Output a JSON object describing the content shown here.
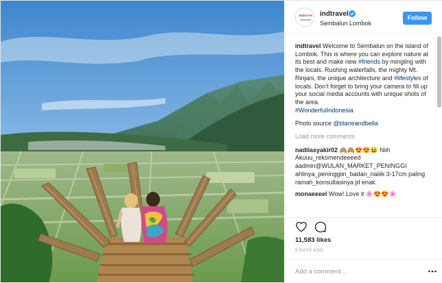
{
  "post": {
    "username": "indtravel",
    "location": "Sembalun Lombok",
    "follow_label": "Follow",
    "avatar_text": "indtravel",
    "avatar_subtext": "indonesia",
    "photo_alt": "Sembalun, Lombok"
  },
  "caption": {
    "username": "indtravel",
    "text_1": " Welcome to Sembalun on the island of Lombok. This is where you can explore nature at its best and make new ",
    "tag_1": "#friends",
    "text_2": " by mingling with the locals. Rushing waterfalls, the mighty Mt. Rinjani, the unique architecture and ",
    "tag_2": "#lifestyles",
    "text_3": " of locals. Don't forget to bring your camera to fill up your social media accounts with unique shots of the area.",
    "tag_3": "#WonderfulIndonesia",
    "source_label": "Photo source ",
    "source_handle": "@blaneandbella"
  },
  "load_more_label": "Load more comments",
  "comments": [
    {
      "username": "nadilasyakir02",
      "text": " 🙈🙈😍😍😆  Niih Akuuu_rekomendeeeed aadmin@WULAN_MARKET_PENINGGI ahlinya_peninggiin_badan_naiiik 3-17cm paling ramah_konsultasinya jd enak."
    },
    {
      "username": "monaeeeel",
      "text": " Wow! Love it 🌸😍😍🌸"
    }
  ],
  "likes_label": "11,583 likes",
  "time_label": "5 DAYS AGO",
  "add_comment_placeholder": "Add a comment...",
  "icons": {
    "verified": "verified-icon",
    "heart": "heart-icon",
    "comment": "comment-icon",
    "more": "more-icon"
  },
  "colors": {
    "follow_button": "#3897f0",
    "hashtag": "#003569",
    "verified": "#3897f0"
  }
}
